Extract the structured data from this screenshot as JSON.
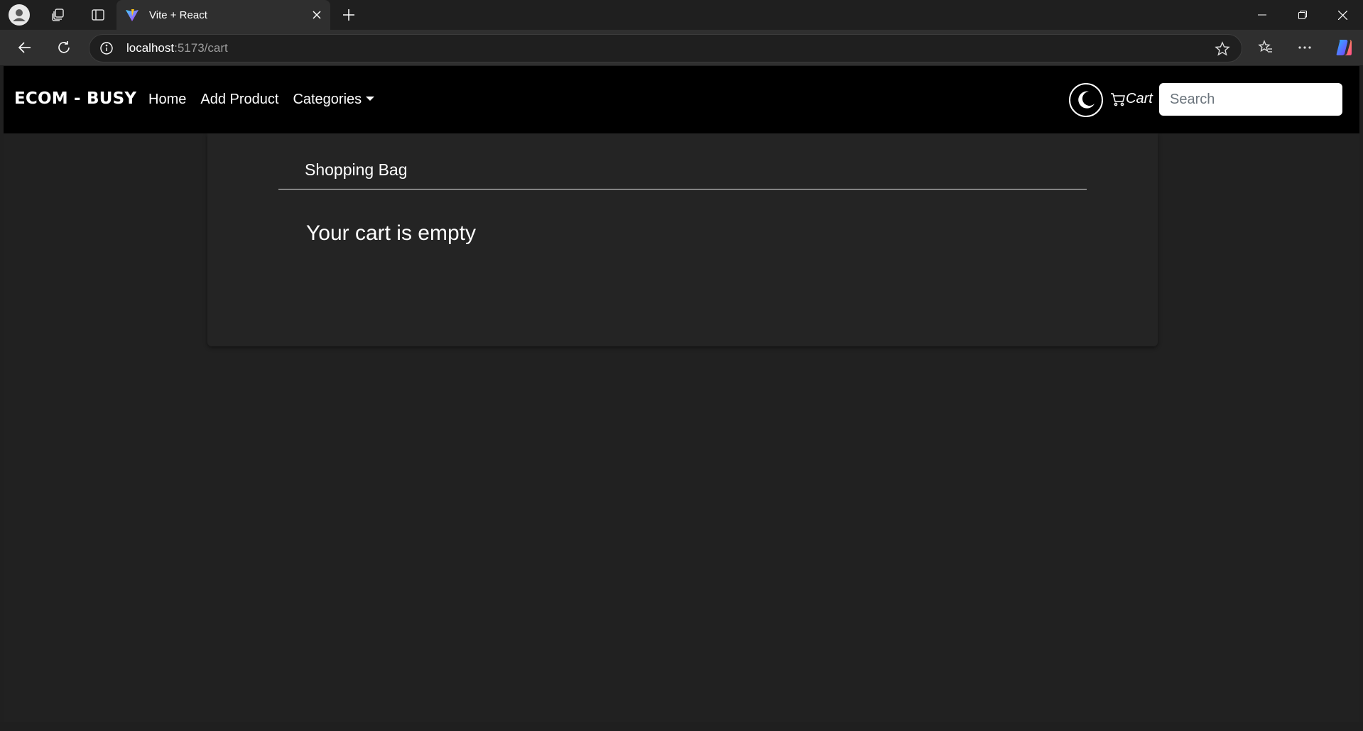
{
  "browser": {
    "tab_title": "Vite + React",
    "url_host": "localhost",
    "url_path": ":5173/cart"
  },
  "navbar": {
    "brand": "ECOM - BUSY",
    "links": [
      "Home",
      "Add Product",
      "Categories"
    ],
    "cart_label": "Cart",
    "search_placeholder": "Search"
  },
  "cart": {
    "title": "Shopping Bag",
    "empty_message": "Your cart is empty"
  },
  "colors": {
    "navbar_bg": "#000000",
    "page_bg": "#212121",
    "card_bg": "#242424",
    "chrome_toolbar": "#2f2f2f"
  },
  "icons": [
    "profile-icon",
    "workspaces-icon",
    "tab-actions-icon",
    "vite-logo-icon",
    "close-icon",
    "plus-icon",
    "minimize-icon",
    "restore-icon",
    "back-icon",
    "refresh-icon",
    "info-icon",
    "star-icon",
    "favorites-icon",
    "more-icon",
    "copilot-icon",
    "moon-icon",
    "cart-icon"
  ]
}
